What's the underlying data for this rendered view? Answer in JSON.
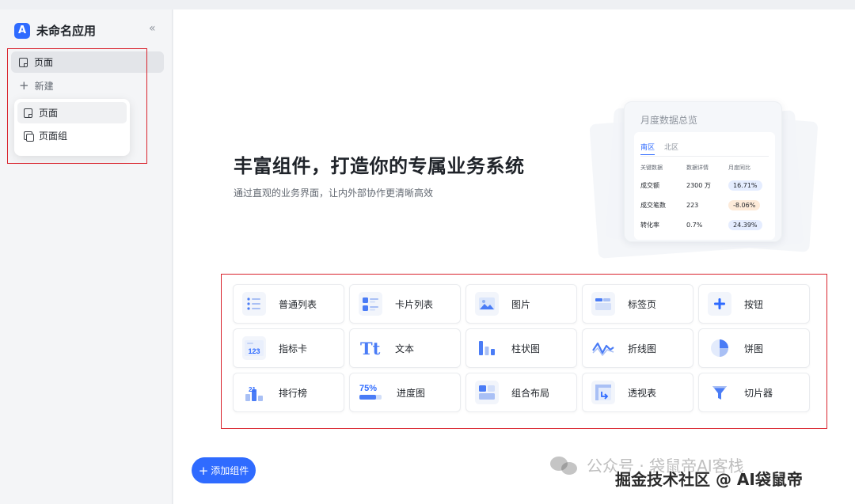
{
  "app": {
    "logo_glyph": "A",
    "title": "未命名应用",
    "collapse_glyph": "«"
  },
  "sidebar": {
    "current_page": "页面",
    "new_label": "新建",
    "dropdown": [
      {
        "label": "页面",
        "icon": "page-icon"
      },
      {
        "label": "页面组",
        "icon": "page-group-icon"
      }
    ]
  },
  "hero": {
    "title": "丰富组件，打造你的专属业务系统",
    "subtitle": "通过直观的业务界面，让内外部协作更清晰高效"
  },
  "preview": {
    "title": "月度数据总览",
    "tabs": [
      "南区",
      "北区"
    ],
    "headers": [
      "关键数据",
      "数据详情",
      "月度同比"
    ],
    "rows": [
      {
        "key": "成交额",
        "detail": "2300 万",
        "yoy": "16.71%"
      },
      {
        "key": "成交笔数",
        "detail": "223",
        "yoy": "-8.06%"
      },
      {
        "key": "转化率",
        "detail": "0.7%",
        "yoy": "24.39%"
      }
    ]
  },
  "components": [
    {
      "label": "普通列表",
      "icon": "list-icon"
    },
    {
      "label": "卡片列表",
      "icon": "card-list-icon"
    },
    {
      "label": "图片",
      "icon": "image-icon"
    },
    {
      "label": "标签页",
      "icon": "tabs-icon"
    },
    {
      "label": "按钮",
      "icon": "button-icon"
    },
    {
      "label": "指标卡",
      "icon": "metric-card-icon",
      "icon_text": "123"
    },
    {
      "label": "文本",
      "icon": "text-icon",
      "icon_text": "Tt"
    },
    {
      "label": "柱状图",
      "icon": "bar-chart-icon"
    },
    {
      "label": "折线图",
      "icon": "line-chart-icon"
    },
    {
      "label": "饼图",
      "icon": "pie-chart-icon"
    },
    {
      "label": "排行榜",
      "icon": "ranking-icon",
      "icon_text": "21"
    },
    {
      "label": "进度图",
      "icon": "progress-icon",
      "icon_text": "75%"
    },
    {
      "label": "组合布局",
      "icon": "combo-layout-icon"
    },
    {
      "label": "透视表",
      "icon": "pivot-table-icon"
    },
    {
      "label": "切片器",
      "icon": "slicer-icon"
    }
  ],
  "add_button": {
    "label": "添加组件"
  },
  "watermark": {
    "line1": "公众号 · 袋鼠帝AI客栈",
    "line2": "掘金技术社区 @ AI袋鼠帝"
  },
  "colors": {
    "accent": "#2f6bff",
    "annotation": "#d9232d",
    "positive_pill": "#e5edff",
    "negative_pill": "#fdebd9"
  }
}
